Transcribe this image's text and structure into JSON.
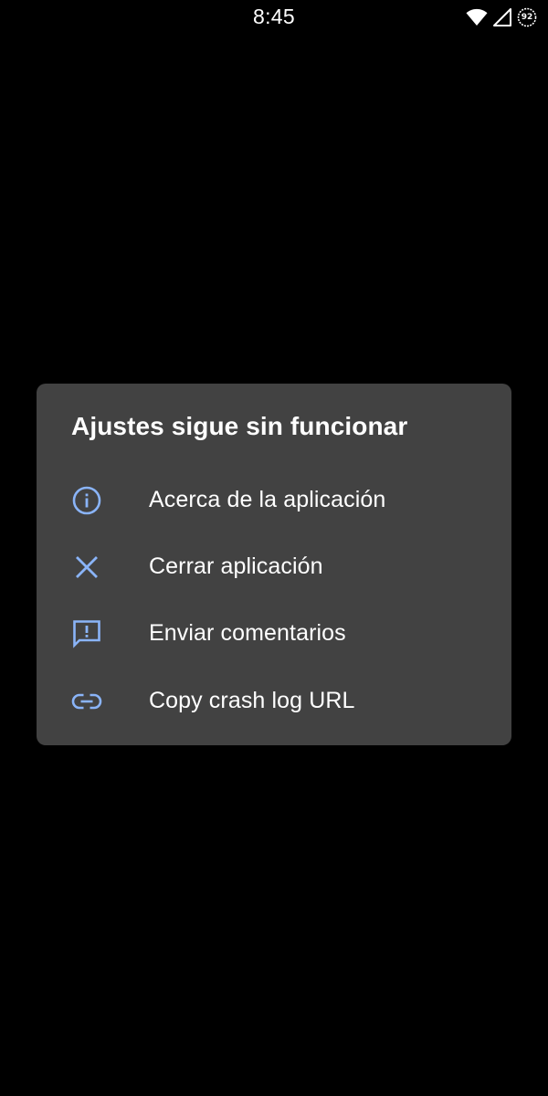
{
  "status_bar": {
    "time": "8:45",
    "battery_level": "92"
  },
  "dialog": {
    "title": "Ajustes sigue sin funcionar",
    "items": [
      {
        "label": "Acerca de la aplicación",
        "icon": "info-icon"
      },
      {
        "label": "Cerrar aplicación",
        "icon": "close-icon"
      },
      {
        "label": "Enviar comentarios",
        "icon": "feedback-icon"
      },
      {
        "label": "Copy crash log URL",
        "icon": "link-icon"
      }
    ]
  },
  "colors": {
    "background": "#000000",
    "dialog_bg": "#424242",
    "icon_accent": "#8ab4f8",
    "text": "#ffffff"
  }
}
